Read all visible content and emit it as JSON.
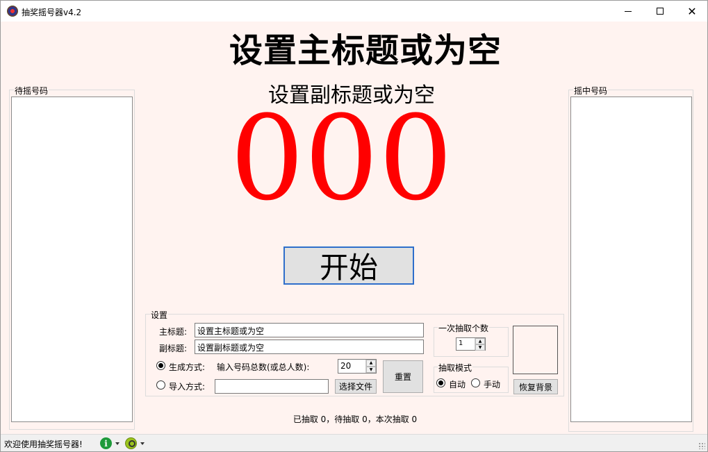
{
  "window": {
    "title": "抽奖摇号器v4.2"
  },
  "display": {
    "main_title": "设置主标题或为空",
    "sub_title": "设置副标题或为空",
    "number": "000",
    "number_color": "#ff0000"
  },
  "left_panel": {
    "label": "待摇号码"
  },
  "right_panel": {
    "label": "摇中号码"
  },
  "start_button": {
    "label": "开始"
  },
  "settings": {
    "label": "设置",
    "main_title_label": "主标题:",
    "main_title_value": "设置主标题或为空",
    "sub_title_label": "副标题:",
    "sub_title_value": "设置副标题或为空",
    "generate_label": "生成方式:",
    "total_label": "输入号码总数(或总人数):",
    "total_value": "20",
    "import_label": "导入方式:",
    "import_value": "",
    "choose_file_label": "选择文件",
    "reset_label": "重置",
    "per_draw_group_label": "一次抽取个数",
    "per_draw_value": "1",
    "mode_group_label": "抽取模式",
    "mode_auto_label": "自动",
    "mode_manual_label": "手动",
    "restore_bg_label": "恢复背景"
  },
  "stats": {
    "text": "已抽取 0，待抽取 0，本次抽取 0"
  },
  "statusbar": {
    "text": "欢迎使用抽奖摇号器!"
  },
  "icons": {
    "app": "lottery-app-icon",
    "info": "info-icon",
    "key": "key-icon"
  },
  "colors": {
    "background": "#fff3f0",
    "accent_border": "#2e6ecb",
    "number": "#ff0000"
  }
}
